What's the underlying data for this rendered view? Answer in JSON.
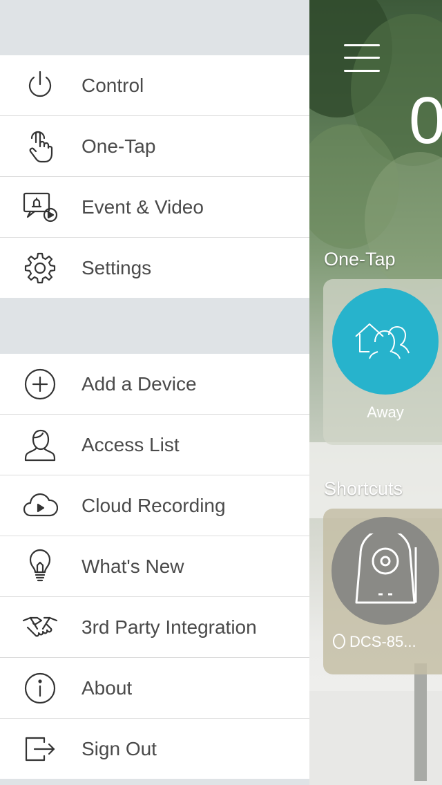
{
  "drawer": {
    "group1": [
      {
        "label": "Control",
        "icon": "power-icon"
      },
      {
        "label": "One-Tap",
        "icon": "tap-hand-icon"
      },
      {
        "label": "Event & Video",
        "icon": "event-video-icon"
      },
      {
        "label": "Settings",
        "icon": "gear-icon"
      }
    ],
    "group2": [
      {
        "label": "Add a Device",
        "icon": "plus-circle-icon"
      },
      {
        "label": "Access List",
        "icon": "user-icon"
      },
      {
        "label": "Cloud Recording",
        "icon": "cloud-play-icon"
      },
      {
        "label": "What's New",
        "icon": "lightbulb-icon"
      },
      {
        "label": "3rd Party Integration",
        "icon": "handshake-icon"
      },
      {
        "label": "About",
        "icon": "info-icon"
      },
      {
        "label": "Sign Out",
        "icon": "sign-out-icon"
      }
    ]
  },
  "home": {
    "header_char": "0",
    "one_tap_title": "One-Tap",
    "away_label": "Away",
    "shortcuts_title": "Shortcuts",
    "shortcut_label": "DCS-85...",
    "accent_color": "#27b3cc"
  }
}
